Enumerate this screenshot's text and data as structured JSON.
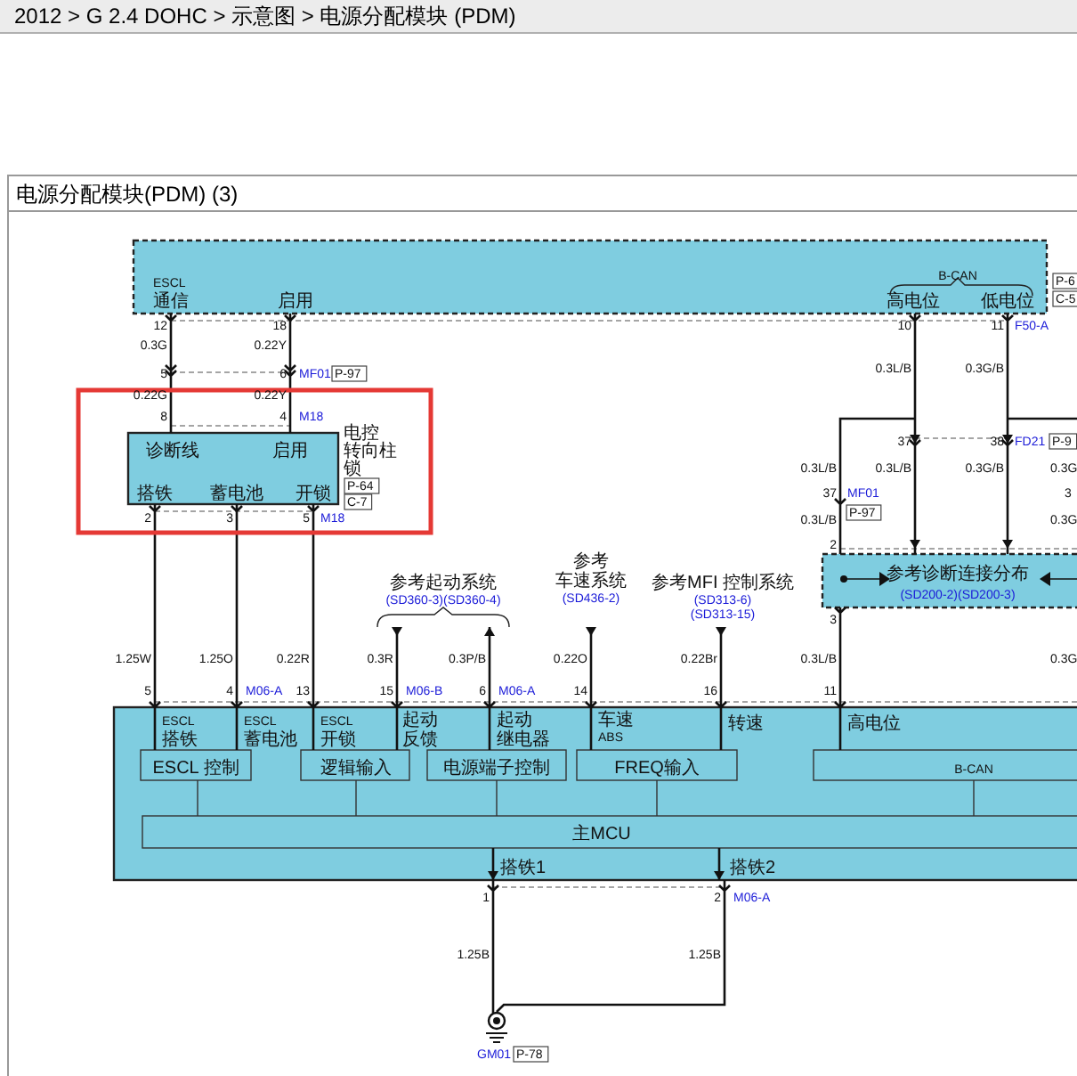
{
  "breadcrumb": "2012 > G 2.4 DOHC > 示意图 > 电源分配模块 (PDM)",
  "panel_title": "电源分配模块(PDM) (3)",
  "diagram": {
    "labels": [
      {
        "text": "ESCL",
        "kind": "plain"
      },
      {
        "text": "通信",
        "kind": "plain"
      },
      {
        "text": "启用",
        "kind": "plain"
      },
      {
        "text": "B-CAN",
        "kind": "plain"
      },
      {
        "text": "高电位",
        "kind": "plain"
      },
      {
        "text": "低电位",
        "kind": "plain"
      },
      {
        "text": "P-6",
        "kind": "tag"
      },
      {
        "text": "C-5",
        "kind": "tag"
      },
      {
        "text": "12",
        "kind": "plain"
      },
      {
        "text": "0.3G",
        "kind": "plain"
      },
      {
        "text": "18",
        "kind": "plain"
      },
      {
        "text": "0.22Y",
        "kind": "plain"
      },
      {
        "text": "5",
        "kind": "plain"
      },
      {
        "text": "6",
        "kind": "plain"
      },
      {
        "text": "MF01",
        "kind": "link"
      },
      {
        "text": "P-97",
        "kind": "tag"
      },
      {
        "text": "10",
        "kind": "plain"
      },
      {
        "text": "11",
        "kind": "plain"
      },
      {
        "text": "F50-A",
        "kind": "link"
      },
      {
        "text": "0.3L/B",
        "kind": "plain"
      },
      {
        "text": "0.3G/B",
        "kind": "plain"
      },
      {
        "text": "0.22G",
        "kind": "plain"
      },
      {
        "text": "0.22Y",
        "kind": "plain"
      },
      {
        "text": "8",
        "kind": "plain"
      },
      {
        "text": "4",
        "kind": "plain"
      },
      {
        "text": "M18",
        "kind": "link"
      },
      {
        "text": "诊断线",
        "kind": "plain"
      },
      {
        "text": "启用",
        "kind": "plain"
      },
      {
        "text": "电控",
        "kind": "plain"
      },
      {
        "text": "转向柱",
        "kind": "plain"
      },
      {
        "text": "锁",
        "kind": "plain"
      },
      {
        "text": "P-64",
        "kind": "tag"
      },
      {
        "text": "C-7",
        "kind": "tag"
      },
      {
        "text": "搭铁",
        "kind": "plain"
      },
      {
        "text": "蓄电池",
        "kind": "plain"
      },
      {
        "text": "开锁",
        "kind": "plain"
      },
      {
        "text": "2",
        "kind": "plain"
      },
      {
        "text": "3",
        "kind": "plain"
      },
      {
        "text": "5",
        "kind": "plain"
      },
      {
        "text": "M18",
        "kind": "link"
      },
      {
        "text": "37",
        "kind": "plain"
      },
      {
        "text": "38",
        "kind": "plain"
      },
      {
        "text": "FD21",
        "kind": "link"
      },
      {
        "text": "P-9",
        "kind": "tag"
      },
      {
        "text": "0.3L/B",
        "kind": "plain"
      },
      {
        "text": "0.3L/B",
        "kind": "plain"
      },
      {
        "text": "0.3G/B",
        "kind": "plain"
      },
      {
        "text": "0.3G",
        "kind": "plain"
      },
      {
        "text": "37",
        "kind": "plain"
      },
      {
        "text": "MF01",
        "kind": "link"
      },
      {
        "text": "P-97",
        "kind": "tag"
      },
      {
        "text": "3",
        "kind": "plain"
      },
      {
        "text": "0.3L/B",
        "kind": "plain"
      },
      {
        "text": "0.3G",
        "kind": "plain"
      },
      {
        "text": "2",
        "kind": "plain"
      },
      {
        "text": "参考诊断连接分布",
        "kind": "plain"
      },
      {
        "text": "(SD200-2)(SD200-3)",
        "kind": "link"
      },
      {
        "text": "3",
        "kind": "plain"
      },
      {
        "text": "参考起动系统",
        "kind": "plain"
      },
      {
        "text": "(SD360-3)(SD360-4)",
        "kind": "link"
      },
      {
        "text": "参考",
        "kind": "plain"
      },
      {
        "text": "车速系统",
        "kind": "plain"
      },
      {
        "text": "(SD436-2)",
        "kind": "link"
      },
      {
        "text": "参考MFI 控制系统",
        "kind": "plain"
      },
      {
        "text": "(SD313-6)",
        "kind": "link"
      },
      {
        "text": "(SD313-15)",
        "kind": "link"
      },
      {
        "text": "1.25W",
        "kind": "plain"
      },
      {
        "text": "1.25O",
        "kind": "plain"
      },
      {
        "text": "0.22R",
        "kind": "plain"
      },
      {
        "text": "0.3R",
        "kind": "plain"
      },
      {
        "text": "0.3P/B",
        "kind": "plain"
      },
      {
        "text": "0.22O",
        "kind": "plain"
      },
      {
        "text": "0.22Br",
        "kind": "plain"
      },
      {
        "text": "0.3L/B",
        "kind": "plain"
      },
      {
        "text": "0.3G",
        "kind": "plain"
      },
      {
        "text": "5",
        "kind": "plain"
      },
      {
        "text": "4",
        "kind": "plain"
      },
      {
        "text": "M06-A",
        "kind": "link"
      },
      {
        "text": "13",
        "kind": "plain"
      },
      {
        "text": "15",
        "kind": "plain"
      },
      {
        "text": "M06-B",
        "kind": "link"
      },
      {
        "text": "6",
        "kind": "plain"
      },
      {
        "text": "M06-A",
        "kind": "link"
      },
      {
        "text": "14",
        "kind": "plain"
      },
      {
        "text": "16",
        "kind": "plain"
      },
      {
        "text": "11",
        "kind": "plain"
      },
      {
        "text": "ESCL",
        "kind": "plain"
      },
      {
        "text": "搭铁",
        "kind": "plain"
      },
      {
        "text": "ESCL",
        "kind": "plain"
      },
      {
        "text": "蓄电池",
        "kind": "plain"
      },
      {
        "text": "ESCL",
        "kind": "plain"
      },
      {
        "text": "开锁",
        "kind": "plain"
      },
      {
        "text": "起动",
        "kind": "plain"
      },
      {
        "text": "反馈",
        "kind": "plain"
      },
      {
        "text": "起动",
        "kind": "plain"
      },
      {
        "text": "继电器",
        "kind": "plain"
      },
      {
        "text": "车速",
        "kind": "plain"
      },
      {
        "text": "ABS",
        "kind": "plain"
      },
      {
        "text": "转速",
        "kind": "plain"
      },
      {
        "text": "高电位",
        "kind": "plain"
      },
      {
        "text": "ESCL 控制",
        "kind": "plain"
      },
      {
        "text": "逻辑输入",
        "kind": "plain"
      },
      {
        "text": "电源端子控制",
        "kind": "plain"
      },
      {
        "text": "FREQ输入",
        "kind": "plain"
      },
      {
        "text": "B-CAN",
        "kind": "plain"
      },
      {
        "text": "主MCU",
        "kind": "plain"
      },
      {
        "text": "搭铁1",
        "kind": "plain"
      },
      {
        "text": "搭铁2",
        "kind": "plain"
      },
      {
        "text": "1",
        "kind": "plain"
      },
      {
        "text": "2",
        "kind": "plain"
      },
      {
        "text": "M06-A",
        "kind": "link"
      },
      {
        "text": "1.25B",
        "kind": "plain"
      },
      {
        "text": "1.25B",
        "kind": "plain"
      },
      {
        "text": "GM01",
        "kind": "link"
      },
      {
        "text": "P-78",
        "kind": "tag"
      }
    ]
  }
}
